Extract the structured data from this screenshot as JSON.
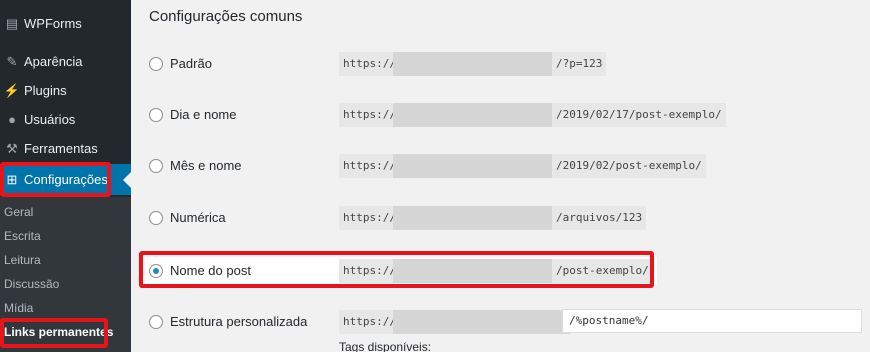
{
  "sidebar": {
    "items": [
      {
        "label": "WPForms",
        "icon": "wpforms-icon"
      },
      {
        "label": "Aparência",
        "icon": "brush-icon"
      },
      {
        "label": "Plugins",
        "icon": "plug-icon"
      },
      {
        "label": "Usuários",
        "icon": "user-icon"
      },
      {
        "label": "Ferramentas",
        "icon": "wrench-icon"
      },
      {
        "label": "Configurações",
        "icon": "settings-icon",
        "active": true
      }
    ],
    "submenu": [
      {
        "label": "Geral"
      },
      {
        "label": "Escrita"
      },
      {
        "label": "Leitura"
      },
      {
        "label": "Discussão"
      },
      {
        "label": "Mídia"
      },
      {
        "label": "Links permanentes",
        "current": true
      }
    ]
  },
  "main": {
    "section_title": "Configurações comuns",
    "options": [
      {
        "label": "Padrão",
        "prefix": "https://",
        "suffix": "/?p=123",
        "checked": false
      },
      {
        "label": "Dia e nome",
        "prefix": "https://",
        "suffix": "/2019/02/17/post-exemplo/",
        "checked": false
      },
      {
        "label": "Mês e nome",
        "prefix": "https://",
        "suffix": "/2019/02/post-exemplo/",
        "checked": false
      },
      {
        "label": "Numérica",
        "prefix": "https://",
        "suffix": "/arquivos/123",
        "checked": false
      },
      {
        "label": "Nome do post",
        "prefix": "https://",
        "suffix": "/post-exemplo/",
        "checked": true
      },
      {
        "label": "Estrutura personalizada",
        "prefix": "https://",
        "value": "/%postname%/",
        "checked": false
      }
    ],
    "tags_label": "Tags disponíveis:"
  },
  "colors": {
    "sidebar_bg": "#23282d",
    "active_bg": "#0073aa",
    "highlight": "#e8141b",
    "radio_checked": "#1e8cbe"
  }
}
